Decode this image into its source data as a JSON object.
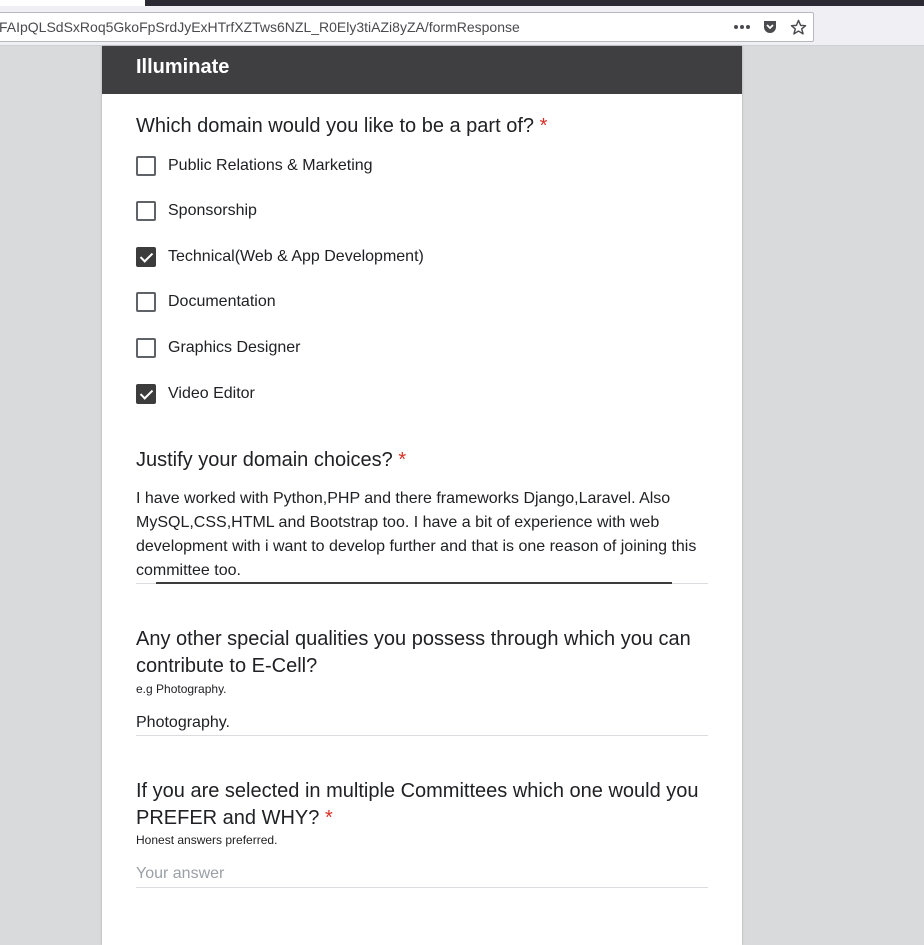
{
  "browser": {
    "url": "FAIpQLSdSxRoq5GkoFpSrdJyExHTrfXZTws6NZL_R0Ely3tiAZi8yZA/formResponse",
    "icons": [
      "more-dots-icon",
      "pocket-icon",
      "bookmark-star-icon"
    ]
  },
  "form": {
    "header_title": "Illuminate",
    "q1": {
      "title": "Which domain would you like to be a part of?",
      "required_mark": "*",
      "options": [
        {
          "label": "Public Relations & Marketing",
          "checked": false
        },
        {
          "label": "Sponsorship",
          "checked": false
        },
        {
          "label": "Technical(Web & App Development)",
          "checked": true
        },
        {
          "label": "Documentation",
          "checked": false
        },
        {
          "label": "Graphics Designer",
          "checked": false
        },
        {
          "label": "Video Editor",
          "checked": true
        }
      ]
    },
    "q2": {
      "title": "Justify your domain choices?",
      "required_mark": "*",
      "answer_line1": "I have worked with Python,PHP and there frameworks Django,Laravel. Also",
      "answer_line2": "MySQL,CSS,HTML and Bootstrap too. I have a bit of experience with web",
      "answer_line3": "development with i want to develop further and that is one reason of joining this",
      "answer_line4": "committee too."
    },
    "q3": {
      "title_line1": "Any other special qualities you possess through which you can",
      "title_line2": "contribute to E-Cell?",
      "description": "e.g Photography.",
      "answer": "Photography."
    },
    "q4": {
      "title_line1": "If you are selected in multiple Committees which one would you",
      "title_line2": "PREFER and WHY?",
      "required_mark": "*",
      "description": "Honest answers preferred.",
      "placeholder": "Your answer"
    }
  }
}
